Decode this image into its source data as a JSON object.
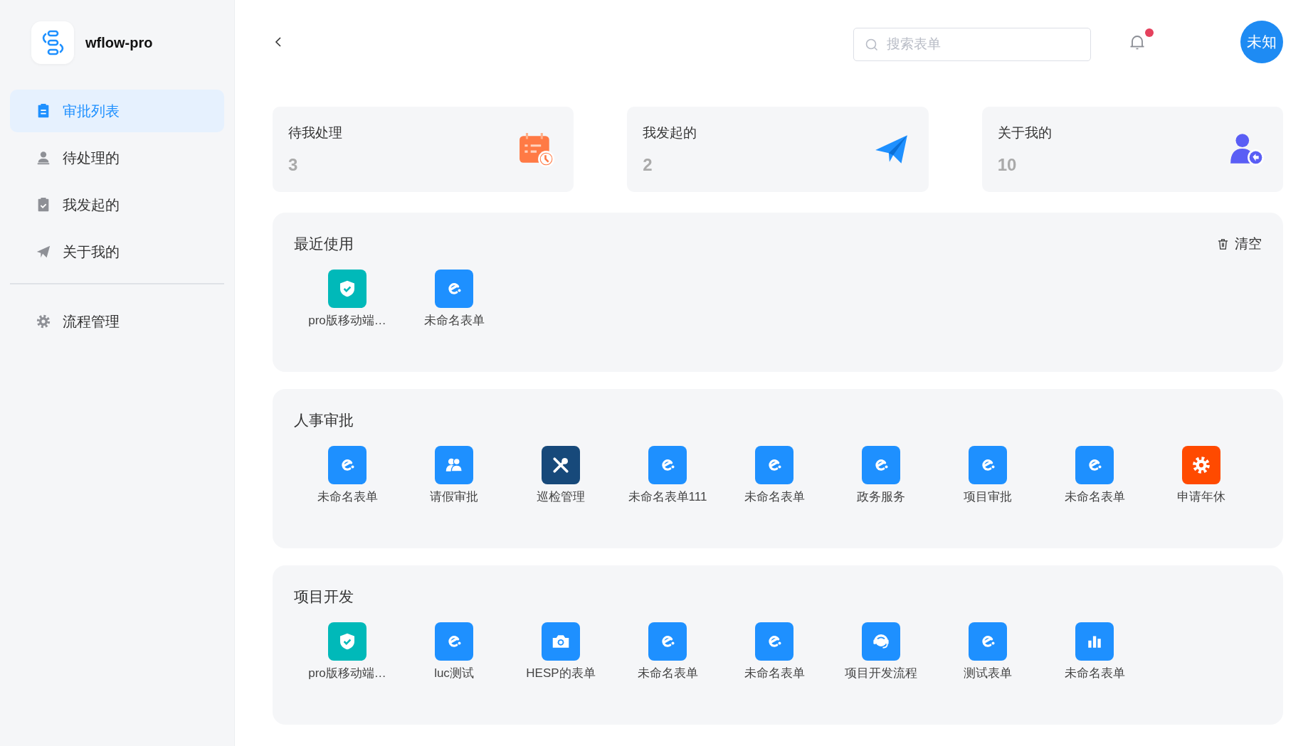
{
  "app": {
    "name": "wflow-pro"
  },
  "sidebar": {
    "items": [
      {
        "label": "审批列表",
        "kind": "clipboard",
        "selected": true
      },
      {
        "label": "待处理的",
        "kind": "user",
        "selected": false
      },
      {
        "label": "我发起的",
        "kind": "check",
        "selected": false
      },
      {
        "label": "关于我的",
        "kind": "plane",
        "selected": false
      }
    ],
    "footer_items": [
      {
        "label": "流程管理",
        "kind": "gear",
        "selected": false
      }
    ]
  },
  "search": {
    "placeholder": "搜索表单"
  },
  "notifications": {
    "unread": true
  },
  "user": {
    "avatar_text": "未知"
  },
  "stats": [
    {
      "title": "待我处理",
      "count": "3",
      "kind": "calendar"
    },
    {
      "title": "我发起的",
      "count": "2",
      "kind": "plane"
    },
    {
      "title": "关于我的",
      "count": "10",
      "kind": "user"
    }
  ],
  "recent": {
    "title": "最近使用",
    "clear_label": "清空",
    "items": [
      {
        "label": "pro版移动端…",
        "kind": "shield",
        "color": "#00b9b9"
      },
      {
        "label": "未命名表单",
        "kind": "form",
        "color": "#1e90ff"
      }
    ]
  },
  "groups": [
    {
      "title": "人事审批",
      "items": [
        {
          "label": "未命名表单",
          "kind": "form",
          "color": "#1e90ff"
        },
        {
          "label": "请假审批",
          "kind": "people",
          "color": "#1e90ff"
        },
        {
          "label": "巡检管理",
          "kind": "tools",
          "color": "#17497a"
        },
        {
          "label": "未命名表单111",
          "kind": "form",
          "color": "#1e90ff"
        },
        {
          "label": "未命名表单",
          "kind": "form",
          "color": "#1e90ff"
        },
        {
          "label": "政务服务",
          "kind": "form",
          "color": "#1e90ff"
        },
        {
          "label": "项目审批",
          "kind": "form",
          "color": "#1e90ff"
        },
        {
          "label": "未命名表单",
          "kind": "form",
          "color": "#1e90ff"
        },
        {
          "label": "申请年休",
          "kind": "gear",
          "color": "#ff4a00"
        }
      ]
    },
    {
      "title": "项目开发",
      "items": [
        {
          "label": "pro版移动端…",
          "kind": "shield",
          "color": "#00b9b9"
        },
        {
          "label": "luc测试",
          "kind": "form",
          "color": "#1e90ff"
        },
        {
          "label": "HESP的表单",
          "kind": "camera",
          "color": "#1e90ff"
        },
        {
          "label": "未命名表单",
          "kind": "form",
          "color": "#1e90ff"
        },
        {
          "label": "未命名表单",
          "kind": "form",
          "color": "#1e90ff"
        },
        {
          "label": "项目开发流程",
          "kind": "headset",
          "color": "#1e90ff"
        },
        {
          "label": "测试表单",
          "kind": "form",
          "color": "#1e90ff"
        },
        {
          "label": "未命名表单",
          "kind": "chart",
          "color": "#1e90ff"
        }
      ]
    }
  ]
}
